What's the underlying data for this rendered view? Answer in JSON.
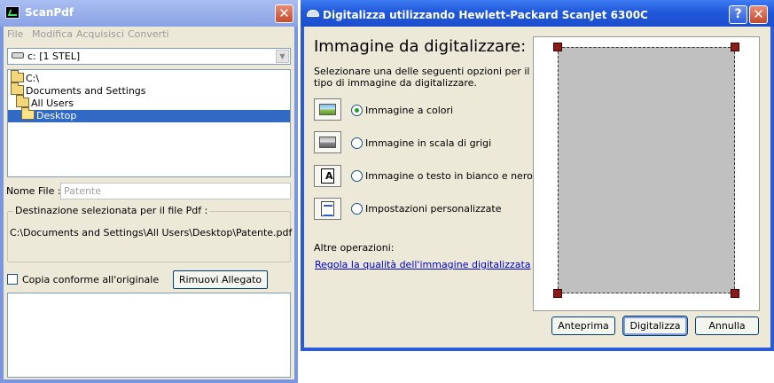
{
  "scanpdf": {
    "title": "ScanPdf",
    "close": "✕",
    "menu": [
      "File",
      "Modifica",
      "Acquisisci",
      "Converti"
    ],
    "drive": {
      "value": "c: [1 STEL]",
      "arrow": "▼"
    },
    "folders": [
      "C:\\",
      "Documents and Settings",
      "All Users",
      "Desktop"
    ],
    "nome_file": {
      "label": "Nome File :",
      "value": "Patente"
    },
    "destinazione": {
      "legend": "Destinazione selezionata per il file Pdf :",
      "path": "C:\\Documents and Settings\\All Users\\Desktop\\Patente.pdf"
    },
    "copia_conforme": {
      "label": "Copia conforme all'originale",
      "checked": false
    },
    "rimuovi_label": "Rimuovi Allegato"
  },
  "scan_dialog": {
    "title": "Digitalizza utilizzando Hewlett-Packard ScanJet 6300C",
    "help": "?",
    "close": "✕",
    "heading": "Immagine da digitalizzare:",
    "instructions": "Selezionare una delle seguenti opzioni per il tipo di immagine da digitalizzare.",
    "options": [
      {
        "label": "Immagine a colori",
        "icon": "color-picture-icon",
        "selected": true
      },
      {
        "label": "Immagine in scala di grigi",
        "icon": "grayscale-picture-icon",
        "selected": false
      },
      {
        "label": "Immagine o testo in bianco e nero",
        "icon": "bw-text-icon",
        "selected": false
      },
      {
        "label": "Impostazioni personalizzate",
        "icon": "custom-settings-icon",
        "selected": false
      }
    ],
    "altre_operazioni": "Altre operazioni:",
    "regola_link": "Regola la qualità dell'immagine digitalizzata",
    "buttons": {
      "anteprima": "Anteprima",
      "digitalizza": "Digitalizza",
      "annulla": "Annulla"
    }
  },
  "colors": {
    "xp_blue_title": "#2058d9",
    "inactive_title": "#8aa3e6",
    "selection": "#316ac5",
    "crop_handle": "#8b1a1a",
    "link": "#0000cc"
  }
}
